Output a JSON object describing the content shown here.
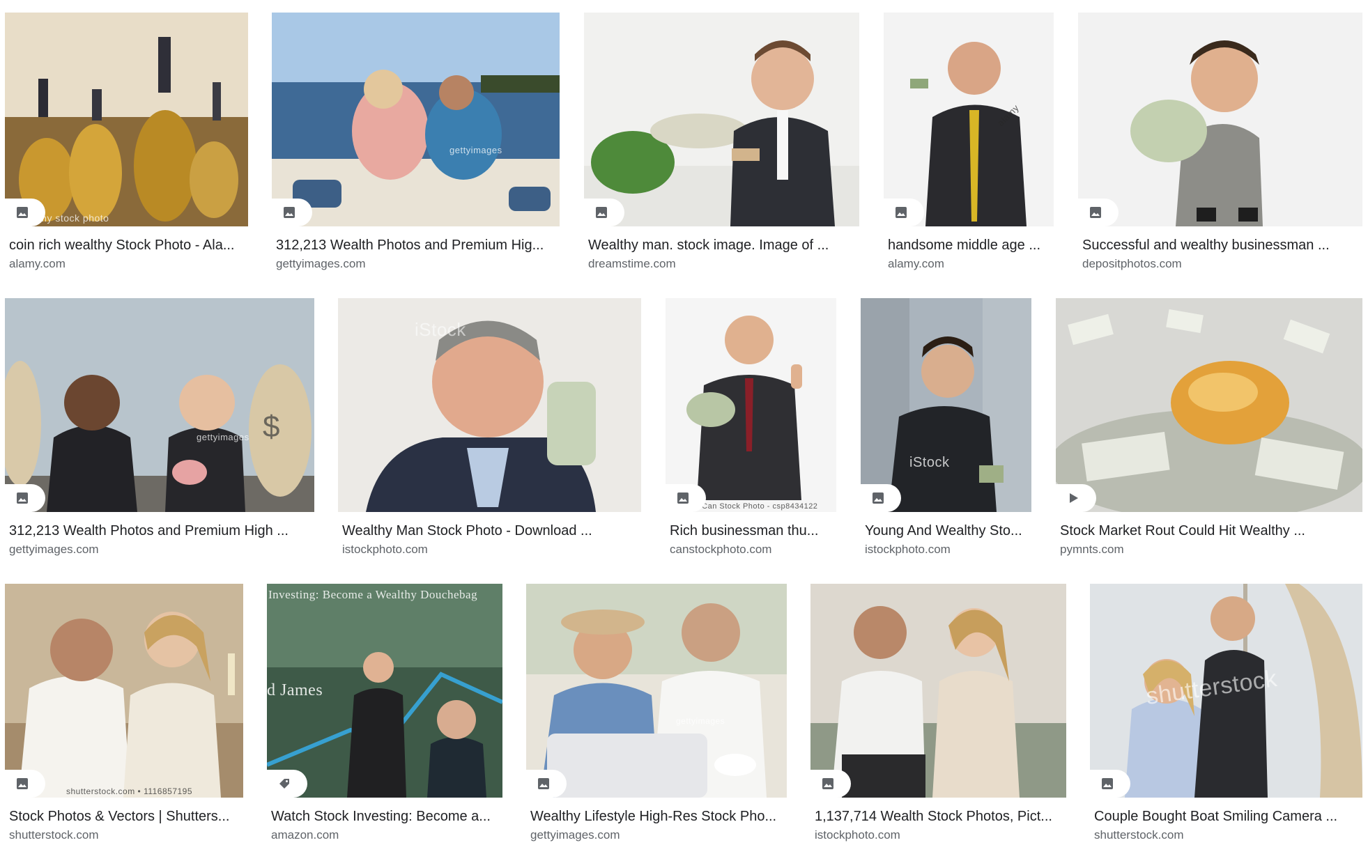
{
  "results": [
    {
      "title": "coin rich wealthy Stock Photo - Ala...",
      "source": "alamy.com",
      "badge": "image-icon",
      "watermark": "amy stock photo"
    },
    {
      "title": "312,213 Wealth Photos and Premium Hig...",
      "source": "gettyimages.com",
      "badge": "image-icon",
      "watermark": "gettyimages"
    },
    {
      "title": "Wealthy man. stock image. Image of ...",
      "source": "dreamstime.com",
      "badge": "image-icon",
      "watermark": ""
    },
    {
      "title": "handsome middle age ...",
      "source": "alamy.com",
      "badge": "image-icon",
      "watermark": "alamy"
    },
    {
      "title": "Successful and wealthy businessman ...",
      "source": "depositphotos.com",
      "badge": "image-icon",
      "watermark": ""
    },
    {
      "title": "312,213 Wealth Photos and Premium High ...",
      "source": "gettyimages.com",
      "badge": "image-icon",
      "watermark": "gettyimages"
    },
    {
      "title": "Wealthy Man Stock Photo - Download ...",
      "source": "istockphoto.com",
      "badge": "",
      "watermark": "iStock"
    },
    {
      "title": "Rich businessman thu...",
      "source": "canstockphoto.com",
      "badge": "image-icon",
      "watermark": "© Can Stock Photo - csp8434122"
    },
    {
      "title": "Young And Wealthy Sto...",
      "source": "istockphoto.com",
      "badge": "image-icon",
      "watermark": "iStock"
    },
    {
      "title": "Stock Market Rout Could Hit Wealthy ...",
      "source": "pymnts.com",
      "badge": "play-icon",
      "watermark": ""
    },
    {
      "title": "Stock Photos & Vectors | Shutters...",
      "source": "shutterstock.com",
      "badge": "image-icon",
      "watermark": "shutterstock.com • 1116857195"
    },
    {
      "title": "Watch Stock Investing: Become a...",
      "source": "amazon.com",
      "badge": "tag-icon",
      "watermark": "Investing: Become a Wealthy Douchebag"
    },
    {
      "title": "Wealthy Lifestyle High-Res Stock Pho...",
      "source": "gettyimages.com",
      "badge": "image-icon",
      "watermark": "gettyimages"
    },
    {
      "title": "1,137,714 Wealth Stock Photos, Pict...",
      "source": "istockphoto.com",
      "badge": "image-icon",
      "watermark": ""
    },
    {
      "title": "Couple Bought Boat Smiling Camera ...",
      "source": "shutterstock.com",
      "badge": "image-icon",
      "watermark": "shutterstock"
    }
  ],
  "second_row_extra_text": {
    "kids_overlay": "$",
    "james": "d James"
  },
  "colors": {
    "title": "#202124",
    "source": "#5f6368",
    "badge_bg": "#ffffff",
    "badge_icon": "#5f6368"
  }
}
